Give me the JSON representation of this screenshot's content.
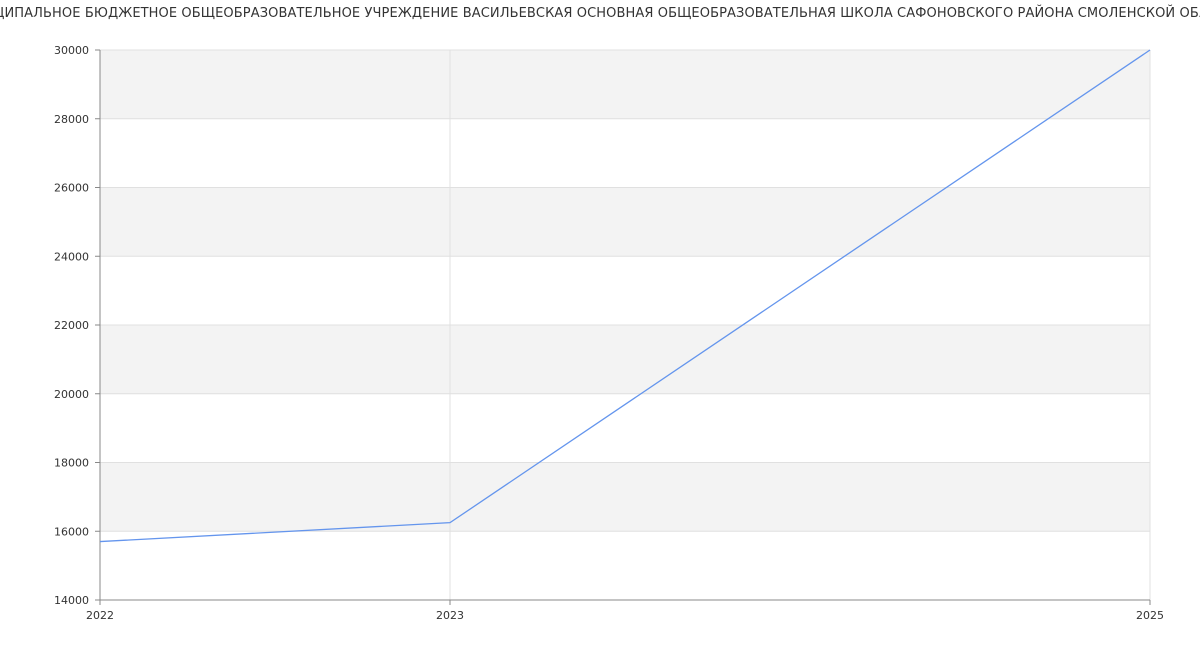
{
  "chart_data": {
    "type": "line",
    "title": "МУНИЦИПАЛЬНОЕ БЮДЖЕТНОЕ ОБЩЕОБРАЗОВАТЕЛЬНОЕ УЧРЕЖДЕНИЕ ВАСИЛЬЕВСКАЯ ОСНОВНАЯ ОБЩЕОБРАЗОВАТЕЛЬНАЯ ШКОЛА САФОНОВСКОГО РАЙОНА СМОЛЕНСКОЙ ОБЛАСТИ",
    "xlabel": "",
    "ylabel": "",
    "x": [
      2022,
      2023,
      2025
    ],
    "x_tick_labels": [
      "2022",
      "2023",
      "2025"
    ],
    "ylim": [
      14000,
      30000
    ],
    "y_ticks": [
      14000,
      16000,
      18000,
      20000,
      22000,
      24000,
      26000,
      28000,
      30000
    ],
    "y_tick_labels": [
      "14000",
      "16000",
      "18000",
      "20000",
      "22000",
      "24000",
      "26000",
      "28000",
      "30000"
    ],
    "series": [
      {
        "values": [
          15700,
          16250,
          30000
        ],
        "color": "#6495ED"
      }
    ],
    "grid": true,
    "alternating_band_color": "#f3f3f3",
    "grid_color": "#e0e0e0",
    "axis_color": "#888888"
  }
}
